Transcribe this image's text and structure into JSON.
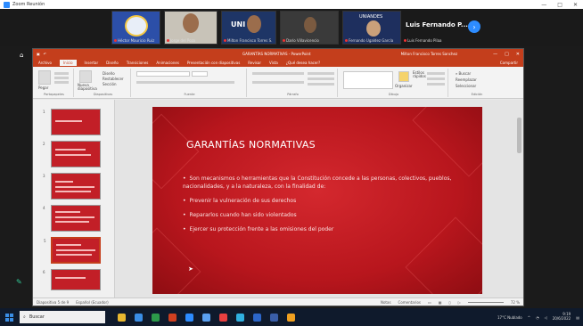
{
  "zoom": {
    "title": "Zoom Reunión",
    "participants": [
      {
        "name": "Héctor Mauricio Ruiz",
        "bg": "#2c4fa8"
      },
      {
        "name": "Jorge del Pozo",
        "bg": "#c8c3b8"
      },
      {
        "name": "Milton Francisco Torres S.",
        "bg": "#1e3566"
      },
      {
        "name": "Darío Villavicencio",
        "bg": "#3a3a3a"
      },
      {
        "name": "Fernando Ugaldez García",
        "bg": "#1e2f5e"
      },
      {
        "name": "Luis Fernando Pilaa",
        "bg": "#f2f2f2"
      }
    ],
    "tile_labels": [
      "UNI LS",
      "UNIANDES"
    ],
    "active_speaker": "Luis Fernando P..."
  },
  "ppt": {
    "title": "GARANTÍAS NORMATIVAS  -  PowerPoint",
    "user": "Milton Francisco Torres Sanchez",
    "window_controls": [
      "—",
      "□",
      "✕"
    ],
    "tabs": [
      "Archivo",
      "Inicio",
      "Insertar",
      "Diseño",
      "Transiciones",
      "Animaciones",
      "Presentación con diapositivas",
      "Revisar",
      "Vista",
      "¿Qué desea hacer?"
    ],
    "active_tab": "Inicio",
    "tab_right": [
      "Compartir"
    ],
    "ribbon_groups": [
      "Portapapeles",
      "Diapositivas",
      "Fuente",
      "Párrafo",
      "Dibujo",
      "Edición"
    ],
    "ribbon_buttons": [
      "Pegar",
      "Nueva diapositiva",
      "Diseño",
      "Restablecer",
      "Sección",
      "Organizar",
      "Estilos rápidos",
      "Buscar",
      "Reemplazar",
      "Seleccionar"
    ],
    "slide_numbers": [
      "1",
      "2",
      "3",
      "4",
      "5",
      "6"
    ],
    "slide": {
      "title": "GARANTÍAS NORMATIVAS",
      "bullets": [
        "Son mecanismos o herramientas que la Constitución concede a las personas, colectivos, pueblos, nacionalidades, y a la naturaleza, con la finalidad de:",
        "Prevenir la vulneración de sus derechos",
        "Repararlos cuando han sido violentados",
        "Ejercer su protección frente a las omisiones del poder"
      ]
    },
    "status": {
      "slide_info": "Diapositiva 5 de 9",
      "language": "Español (Ecuador)",
      "notes": "Notas",
      "comments": "Comentarios",
      "zoom": "72 %"
    }
  },
  "taskbar": {
    "search_placeholder": "Buscar",
    "weather": "17°C Nublado",
    "time": "9:19",
    "date": "20/6/2022",
    "icon_colors": [
      "#e8b830",
      "#3a8ee6",
      "#2c9a4a",
      "#d04020",
      "#2d8cff",
      "#5aa0f0",
      "#e84040",
      "#30b0e0",
      "#2c66c8",
      "#3a5ea8",
      "#f0a020"
    ]
  }
}
